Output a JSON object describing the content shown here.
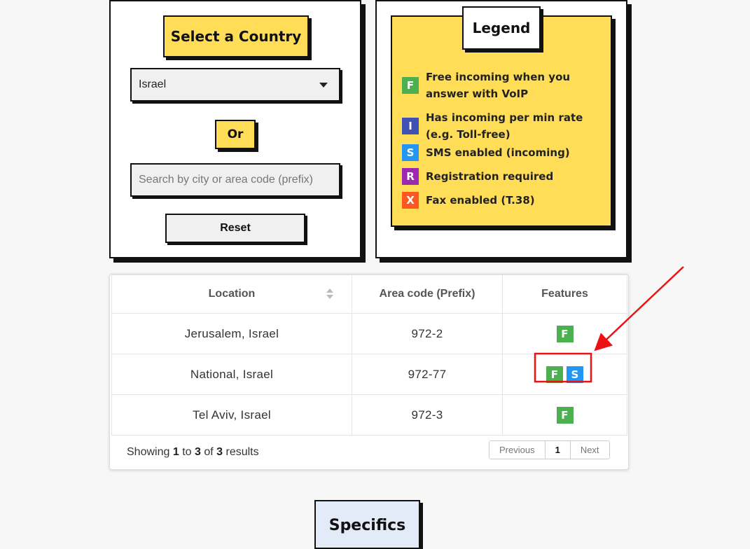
{
  "country_panel": {
    "title": "Select a Country",
    "selected_country": "Israel",
    "or_label": "Or",
    "search_placeholder": "Search by city or area code (prefix)",
    "reset_label": "Reset"
  },
  "legend": {
    "title": "Legend",
    "items": [
      {
        "code": "F",
        "color": "#4caf50",
        "text": "Free incoming when you answer with VoIP"
      },
      {
        "code": "I",
        "color": "#3f51b5",
        "text": "Has incoming per min rate (e.g. Toll-free)"
      },
      {
        "code": "S",
        "color": "#2196f3",
        "text": "SMS enabled (incoming)"
      },
      {
        "code": "R",
        "color": "#9c27b0",
        "text": "Registration required"
      },
      {
        "code": "X",
        "color": "#ff5722",
        "text": "Fax enabled (T.38)"
      }
    ]
  },
  "table": {
    "headers": [
      "Location",
      "Area code (Prefix)",
      "Features"
    ],
    "rows": [
      {
        "location": "Jerusalem, Israel",
        "prefix": "972-2",
        "features": [
          "F"
        ]
      },
      {
        "location": "National, Israel",
        "prefix": "972-77",
        "features": [
          "F",
          "S"
        ]
      },
      {
        "location": "Tel Aviv, Israel",
        "prefix": "972-3",
        "features": [
          "F"
        ]
      }
    ],
    "info": {
      "prefix": "Showing",
      "from": "1",
      "to_word": "to",
      "to": "3",
      "of_word": "of",
      "total": "3",
      "suffix": "results"
    },
    "pager": {
      "previous": "Previous",
      "current": "1",
      "next": "Next"
    }
  },
  "specifics_title": "Specifics",
  "colors": {
    "feature_F": "#4caf50",
    "feature_S": "#2196f3",
    "annotation": "#ee1111",
    "accent_yellow": "#ffdd57"
  }
}
